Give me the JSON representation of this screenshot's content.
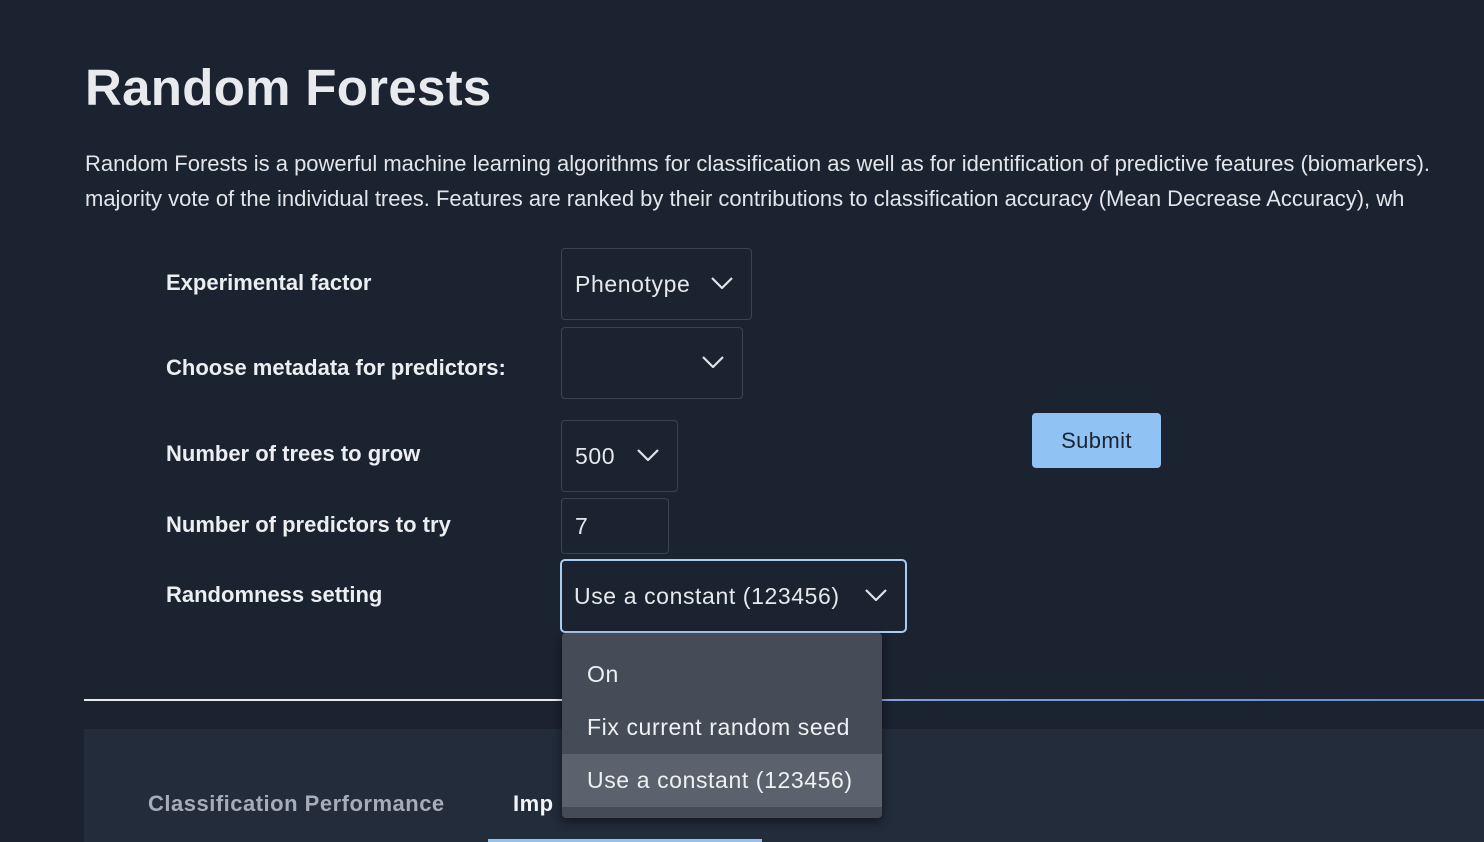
{
  "page": {
    "title": "Random Forests",
    "description_lines": [
      "Random Forests is a powerful machine learning algorithms for classification as well as for identification of predictive features (biomarkers).",
      "majority vote of the individual trees. Features are ranked by their contributions to classification accuracy (Mean Decrease Accuracy), wh"
    ]
  },
  "form": {
    "experimental_factor": {
      "label": "Experimental factor",
      "value": "Phenotype"
    },
    "metadata_predictors": {
      "label": "Choose metadata for predictors:",
      "value": ""
    },
    "num_trees": {
      "label": "Number of trees to grow",
      "value": "500"
    },
    "num_predictors": {
      "label": "Number of predictors to try",
      "value": "7"
    },
    "randomness": {
      "label": "Randomness setting",
      "value": "Use a constant (123456)",
      "options": [
        "On",
        "Fix current random seed",
        "Use a constant (123456)"
      ],
      "selected_index": 2
    },
    "submit_label": "Submit"
  },
  "results": {
    "tabs": [
      {
        "label": "Classification Performance",
        "active": false
      },
      {
        "label": "Imp",
        "active": true
      }
    ]
  },
  "colors": {
    "background": "#1b2230",
    "panel": "#222c3b",
    "accent": "#90c2f3",
    "focus_border": "#a9cdf5",
    "menu_bg": "#454c58",
    "menu_selected": "#5b626d"
  },
  "icons": {
    "dropdown": "chevron-down-icon"
  }
}
